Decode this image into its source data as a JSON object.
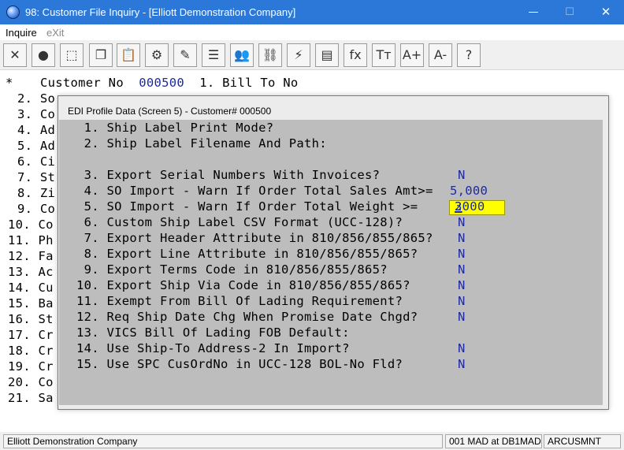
{
  "window": {
    "title": "98: Customer File Inquiry - [Elliott Demonstration Company]",
    "controls": {
      "minimize": "—",
      "maximize": "☐",
      "close": "✕"
    }
  },
  "menu": {
    "inquire": "Inquire",
    "exit": "eXit"
  },
  "toolbar": [
    {
      "name": "close-icon",
      "glyph": "✕"
    },
    {
      "name": "globe-icon",
      "glyph": "●"
    },
    {
      "name": "select-icon",
      "glyph": "⬚"
    },
    {
      "name": "copy-icon",
      "glyph": "❐"
    },
    {
      "name": "paste-icon",
      "glyph": "📋"
    },
    {
      "name": "settings-icon",
      "glyph": "⚙"
    },
    {
      "name": "edit-icon",
      "glyph": "✎"
    },
    {
      "name": "notes-icon",
      "glyph": "☰"
    },
    {
      "name": "users-icon",
      "glyph": "👥"
    },
    {
      "name": "link-icon",
      "glyph": "⛓"
    },
    {
      "name": "lightning-icon",
      "glyph": "⚡"
    },
    {
      "name": "screen-icon",
      "glyph": "▤"
    },
    {
      "name": "function-icon",
      "glyph": "fx"
    },
    {
      "name": "font-size-icon",
      "glyph": "Tт"
    },
    {
      "name": "increase-font-icon",
      "glyph": "A+"
    },
    {
      "name": "decrease-font-icon",
      "glyph": "A-"
    },
    {
      "name": "help-icon",
      "glyph": "?"
    }
  ],
  "background": {
    "header_star": "*",
    "header_label": "Customer No",
    "customer_no": "000500",
    "header_field": "1. Bill To No",
    "lines": [
      "2. So",
      "3. Co",
      "4. Ad",
      "5. Ad",
      "6. Ci",
      "7. St",
      "8. Zi",
      "9. Co",
      "10. Co",
      "11. Ph",
      "12. Fa",
      "13. Ac",
      "14. Cu",
      "15. Ba",
      "16. St",
      "17. Cr",
      "18. Cr",
      "19. Cr",
      "20. Co",
      "21. Sa"
    ]
  },
  "dialog": {
    "title": "EDI Profile Data (Screen 5) - Customer# 000500",
    "items": [
      {
        "label": " 1. Ship Label Print Mode?",
        "value": ""
      },
      {
        "label": " 2. Ship Label Filename And Path:",
        "value": ""
      },
      {
        "label": "",
        "value": ""
      },
      {
        "label": " 3. Export Serial Numbers With Invoices?",
        "value": "N"
      },
      {
        "label": " 4. SO Import - Warn If Order Total Sales Amt>=",
        "value": "5,000"
      },
      {
        "label": " 5. SO Import - Warn If Order Total Weight >=",
        "value": "32000"
      },
      {
        "label": " 6. Custom Ship Label CSV Format (UCC-128)?",
        "value": "N"
      },
      {
        "label": " 7. Export Header Attribute in 810/856/855/865?",
        "value": "N"
      },
      {
        "label": " 8. Export Line Attribute in 810/856/855/865?",
        "value": "N"
      },
      {
        "label": " 9. Export Terms Code in 810/856/855/865?",
        "value": "N"
      },
      {
        "label": "10. Export Ship Via Code in 810/856/855/865?",
        "value": "N"
      },
      {
        "label": "11. Exempt From Bill Of Lading Requirement?",
        "value": "N"
      },
      {
        "label": "12. Req Ship Date Chg When Promise Date Chgd?",
        "value": "N"
      },
      {
        "label": "13. VICS Bill Of Lading FOB Default:",
        "value": ""
      },
      {
        "label": "14. Use Ship-To Address-2 In Import?",
        "value": "N"
      },
      {
        "label": "15. Use SPC CusOrdNo in UCC-128 BOL-No Fld?",
        "value": "N"
      }
    ],
    "weight_first_char": "3",
    "weight_rest": "2000"
  },
  "status": {
    "company": "Elliott Demonstration Company",
    "session": "001 MAD at DB1MAD",
    "program": "ARCUSMNT"
  },
  "colors": {
    "titlebar": "#2b78d8",
    "input_bg": "#ffff00",
    "value_text": "#1f2a9e",
    "dialog_body": "#bdbdbd"
  }
}
